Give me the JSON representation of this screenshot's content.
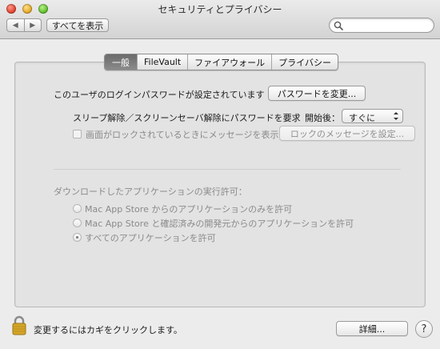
{
  "window": {
    "title": "セキュリティとプライバシー"
  },
  "toolbar": {
    "back_glyph": "◀",
    "forward_glyph": "▶",
    "show_all_label": "すべてを表示",
    "search_placeholder": ""
  },
  "tabs": [
    {
      "label": "一般",
      "selected": true
    },
    {
      "label": "FileVault",
      "selected": false
    },
    {
      "label": "ファイアウォール",
      "selected": false
    },
    {
      "label": "プライバシー",
      "selected": false
    }
  ],
  "general": {
    "login_password_text": "このユーザのログインパスワードが設定されています",
    "change_password_button": "パスワードを変更...",
    "require_password_label": "スリープ解除／スクリーンセーバ解除にパスワードを要求",
    "start_after_label": "開始後：",
    "start_after_value": "すぐに",
    "show_message_label": "画面がロックされているときにメッセージを表示",
    "show_message_checked": false,
    "set_lock_message_button": "ロックのメッセージを設定...",
    "allow_apps_heading": "ダウンロードしたアプリケーションの実行許可：",
    "allow_options": [
      {
        "label": "Mac App Store からのアプリケーションのみを許可",
        "checked": false
      },
      {
        "label": "Mac App Store と確認済みの開発元からのアプリケーションを許可",
        "checked": false
      },
      {
        "label": "すべてのアプリケーションを許可",
        "checked": true
      }
    ]
  },
  "footer": {
    "lock_text": "変更するにはカギをクリックします。",
    "advanced_button": "詳細...",
    "help_label": "?"
  },
  "icons": {
    "lock": "lock-icon",
    "search": "search-icon",
    "help": "help-icon",
    "back": "back-arrow-icon",
    "forward": "forward-arrow-icon"
  },
  "colors": {
    "window_bg": "#ececec",
    "panel_bg": "#e3e3e3",
    "selected_tab_bg": "#787878",
    "lock_gold": "#d4a62a"
  }
}
